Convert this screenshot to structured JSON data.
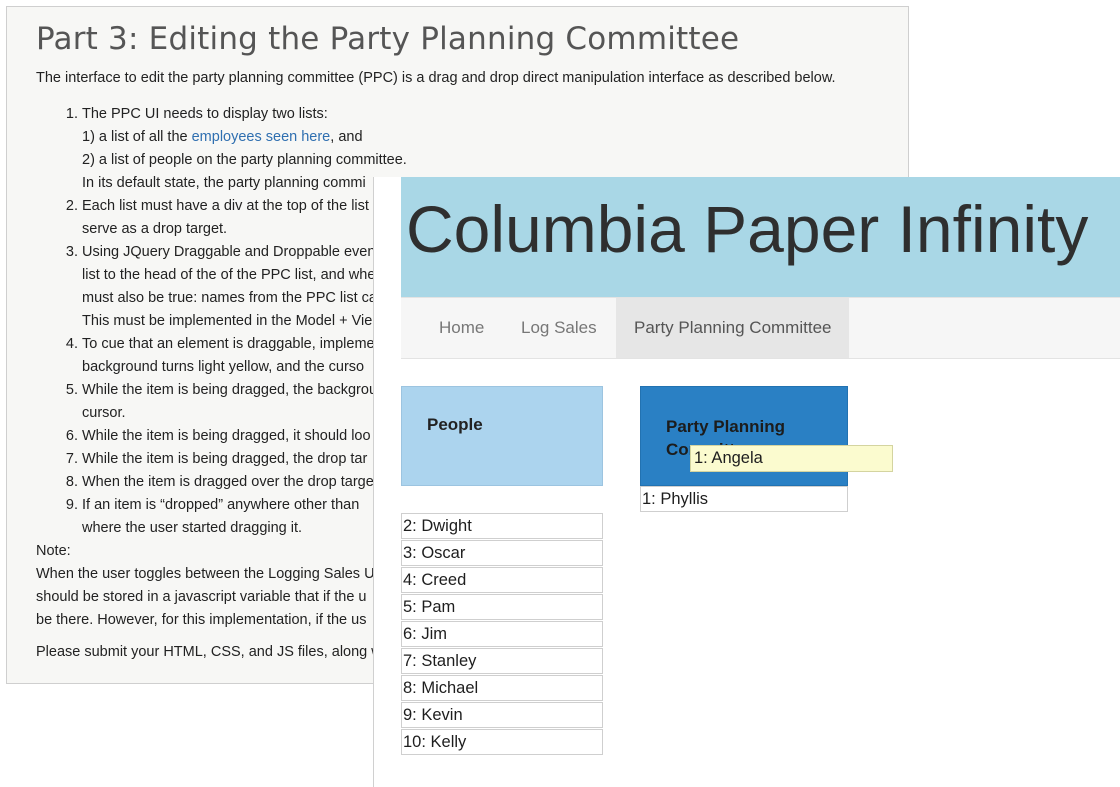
{
  "doc": {
    "title": "Part 3: Editing the Party Planning Committee",
    "intro": "The interface to edit the party planning committee (PPC) is a drag and drop direct manipulation interface as described below.",
    "items": [
      {
        "lines": [
          "The PPC UI needs to display two lists:"
        ],
        "sub_a_pre": "1) a list of all the ",
        "sub_a_link": "employees seen here",
        "sub_a_post": ", and",
        "sub_b": "2) a list of people on the party planning committee.",
        "sub_c": "In its default state, the party planning commi"
      },
      {
        "lines": [
          "Each list must have a div at the top of the list",
          "serve as a drop target."
        ]
      },
      {
        "lines": [
          "Using JQuery Draggable and Droppable even",
          "list to the head of the of the PPC list, and whe",
          "must also be true: names from the PPC list ca",
          "This must be implemented in the Model + Vie"
        ]
      },
      {
        "lines": [
          "To cue that an element is draggable, impleme",
          "background turns light yellow, and the curso"
        ]
      },
      {
        "lines": [
          "While the item is being dragged, the backgrou",
          "cursor."
        ]
      },
      {
        "lines": [
          "While the item is being dragged, it should loo"
        ]
      },
      {
        "lines": [
          "While the item is being dragged, the drop tar"
        ]
      },
      {
        "lines": [
          "When the item is dragged over the drop targe"
        ]
      },
      {
        "lines": [
          "If an item is “dropped” anywhere other than",
          "where the user started dragging it."
        ]
      }
    ],
    "note_label": "Note:",
    "note_lines": [
      "When the user toggles between the Logging Sales U",
      "should be stored in a javascript variable that if the u",
      "be there. However, for this implementation, if the us"
    ],
    "submit": "Please submit your HTML, CSS, and JS files, along w"
  },
  "app": {
    "title": "Columbia Paper Infinity",
    "nav": [
      "Home",
      "Log Sales",
      "Party Planning Committee"
    ],
    "active_tab": "Party Planning Committee",
    "people_header": "People",
    "ppc_header": "Party Planning Committee",
    "people": [
      "2: Dwight",
      "3: Oscar",
      "4: Creed",
      "5: Pam",
      "6: Jim",
      "7: Stanley",
      "8: Michael",
      "9: Kevin",
      "10: Kelly"
    ],
    "ppc": [
      "1: Phyllis"
    ],
    "dragging": "1: Angela",
    "colors": {
      "banner": "#a9d7e6",
      "people_header": "#acd4ee",
      "ppc_header": "#2a80c4",
      "drag_bg": "#fbfbcf",
      "link": "#2f6fb0"
    }
  }
}
